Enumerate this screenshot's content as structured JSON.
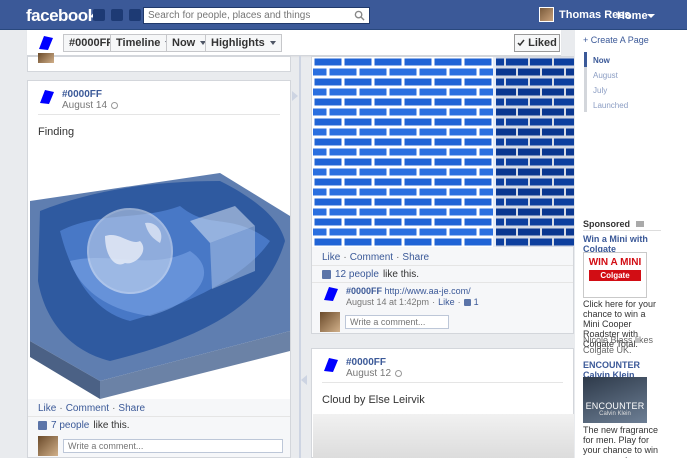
{
  "topbar": {
    "logo": "facebook",
    "search_placeholder": "Search for people, places and things",
    "user_name": "Thomas Rees",
    "home_label": "Home"
  },
  "timeline_header": {
    "page_name": "#0000FF",
    "timeline_label": "Timeline",
    "now_label": "Now",
    "highlights_label": "Highlights",
    "liked_label": "Liked"
  },
  "left_post": {
    "author": "#0000FF",
    "date": "August 14",
    "text": "Finding",
    "actions": {
      "like": "Like",
      "comment": "Comment",
      "share": "Share"
    },
    "likes_people": "7 people",
    "likes_suffix": "like this.",
    "comment_placeholder": "Write a comment..."
  },
  "right_post_top": {
    "actions": {
      "like": "Like",
      "comment": "Comment",
      "share": "Share"
    },
    "likes_people": "12 people",
    "likes_suffix": "like this.",
    "comment_author": "#0000FF",
    "comment_link": "http://www.aa-je.com/",
    "comment_meta": "August 14 at 1:42pm",
    "comment_like": "Like",
    "comment_like_count": "1",
    "comment_placeholder": "Write a comment..."
  },
  "right_post_bottom": {
    "author": "#0000FF",
    "date": "August 12",
    "text": "Cloud by Else Leirvik"
  },
  "sidebar": {
    "create_page": "+ Create A Page",
    "years": [
      "Now",
      "August",
      "July",
      "Launched"
    ],
    "sponsored": "Sponsored",
    "ads": [
      {
        "title": "Win a Mini with Colgate",
        "image_text": "WIN A MINI",
        "image_brand": "Colgate",
        "body": "Click here for your chance to win a Mini Cooper Roadster with Colgate Total.",
        "likes": "Nicole Blass likes Colgate UK."
      },
      {
        "title": "ENCOUNTER Calvin Klein",
        "image_text": "ENCOUNTER",
        "image_brand": "Calvin Klein",
        "body": "The new fragrance for men. Play for your chance to win an encounter weekend"
      }
    ]
  },
  "colors": {
    "brand": "#3b5998",
    "page_icon": "#0000ff",
    "brick_blue": "#1f63d6"
  }
}
